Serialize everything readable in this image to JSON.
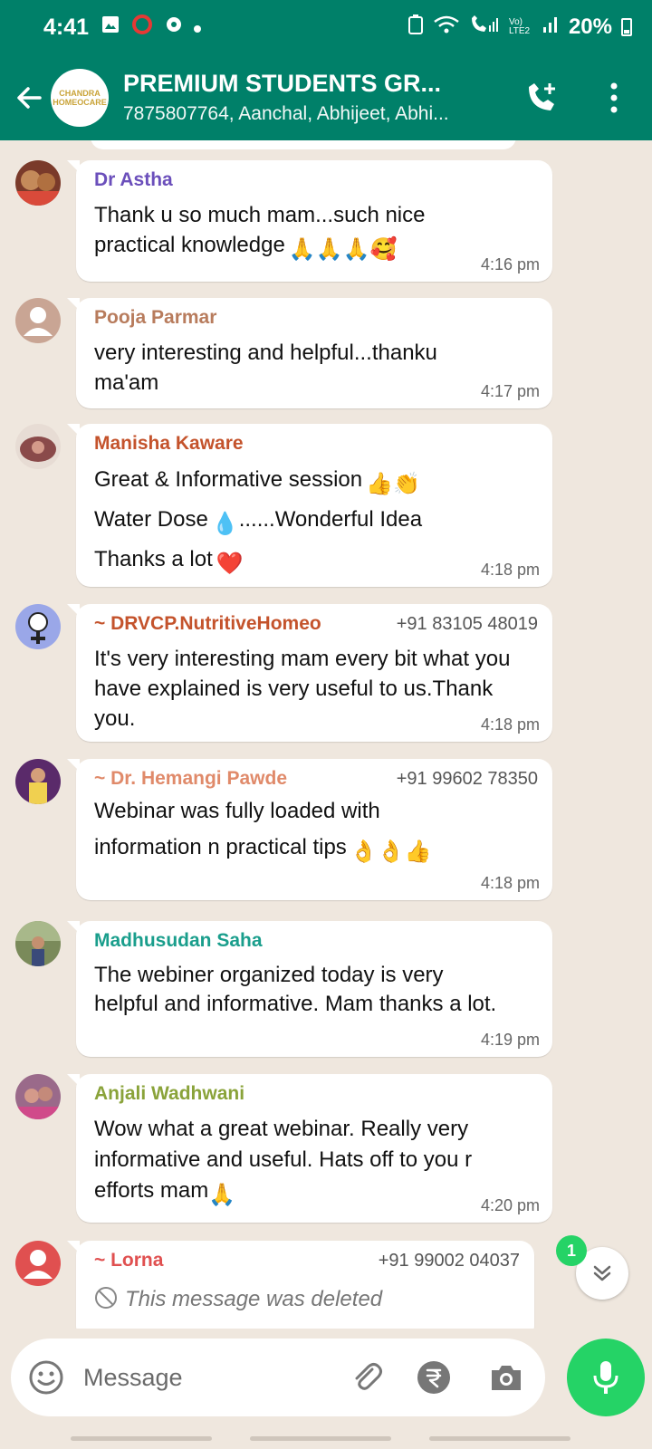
{
  "status_bar": {
    "time": "4:41",
    "network_label": "Vo) LTE2",
    "battery": "20%"
  },
  "header": {
    "title": "PREMIUM STUDENTS GR...",
    "members": "7875807764, Aanchal, Abhijeet, Abhi...",
    "avatar_text": "CHANDRA HOMEOCARE"
  },
  "messages": [
    {
      "sender": "Dr Astha",
      "sender_color": "#6b4fbb",
      "phone": "",
      "text": "Thank u so much mam...such nice practical knowledge",
      "emojis": "🙏🙏🙏🥰",
      "time": "4:16 pm"
    },
    {
      "sender": "Pooja Parmar",
      "sender_color": "#b87c5d",
      "phone": "",
      "text": "very interesting and helpful...thanku ma'am",
      "emojis": "",
      "time": "4:17 pm"
    },
    {
      "sender": "Manisha Kaware",
      "sender_color": "#c4532c",
      "phone": "",
      "line1": "Great & Informative session",
      "line1_emoji": "👍👏",
      "line2": "Water Dose",
      "line2_emoji": "💧",
      "line2_tail": "......Wonderful Idea",
      "line3": "Thanks a lot",
      "line3_emoji": "❤️",
      "time": "4:18 pm"
    },
    {
      "sender": "~ DRVCP.NutritiveHomeo",
      "sender_color": "#c4532c",
      "phone": "+91 83105 48019",
      "text": "It's very interesting mam every bit what you have explained is very useful to us.Thank you.",
      "emojis": "",
      "time": "4:18 pm"
    },
    {
      "sender": "~ Dr. Hemangi Pawde",
      "sender_color": "#e08a6a",
      "phone": "+91 99602 78350",
      "line1": "Webinar was fully loaded with",
      "line2": "information n practical tips",
      "emojis": "👌👌👍",
      "time": "4:18 pm"
    },
    {
      "sender": "Madhusudan Saha",
      "sender_color": "#1a9e8c",
      "phone": "",
      "text": "The webiner organized today is very helpful and informative. Mam thanks a lot.",
      "emojis": "",
      "time": "4:19 pm"
    },
    {
      "sender": "Anjali Wadhwani",
      "sender_color": "#8aa33a",
      "phone": "",
      "text": "Wow what a great webinar. Really very informative and useful. Hats off to you r efforts mam",
      "emojis": "🙏",
      "time": "4:20 pm"
    },
    {
      "sender": "~ Lorna",
      "sender_color": "#e05050",
      "phone": "+91 99002 04037",
      "text": "This message was deleted",
      "emojis": "",
      "time": ""
    }
  ],
  "unread_count": "1",
  "input": {
    "placeholder": "Message"
  },
  "colors": {
    "header": "#008069",
    "accent": "#25d366",
    "chat_bg": "#efe7de"
  }
}
